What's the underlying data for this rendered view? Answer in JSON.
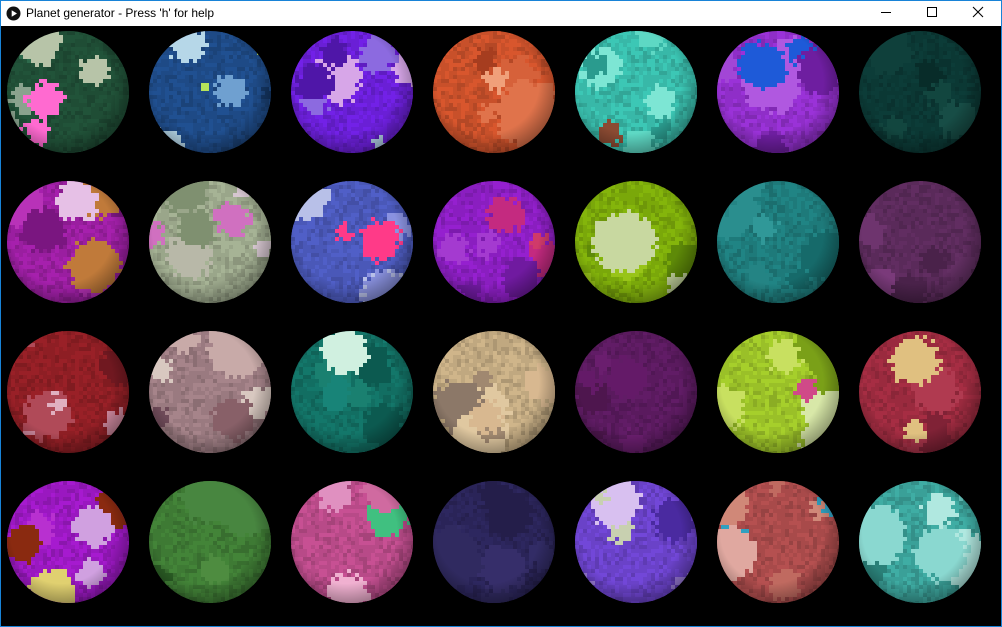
{
  "window": {
    "title": "Planet generator - Press 'h' for help",
    "icon": "play-circle-icon",
    "controls": {
      "minimize_icon": "minimize-icon",
      "maximize_icon": "maximize-icon",
      "close_icon": "close-icon"
    }
  },
  "colors": {
    "canvas_background": "#000000",
    "window_border": "#1883d7"
  },
  "planets": [
    {
      "base": "#1f4d35",
      "accents": [
        "#ff6ad0",
        "#b7c4a8",
        "#8aa38e",
        "#2d6a4c"
      ]
    },
    {
      "base": "#1e4a86",
      "accents": [
        "#b6d7e8",
        "#b7e35a",
        "#6fa0d0",
        "#143766"
      ]
    },
    {
      "base": "#6a1fd6",
      "accents": [
        "#d7a6e8",
        "#8c6ae0",
        "#4f16a8",
        "#b9d8f0"
      ]
    },
    {
      "base": "#c8502a",
      "accents": [
        "#e0734b",
        "#a63d1f",
        "#d6613a",
        "#f0a07a"
      ]
    },
    {
      "base": "#38b8a8",
      "accents": [
        "#5ed8c4",
        "#2a9b8e",
        "#7de6d4",
        "#8a4a32"
      ]
    },
    {
      "base": "#8f2ec8",
      "accents": [
        "#b058e0",
        "#6e1ea0",
        "#1e5ad8",
        "#a246d6"
      ]
    },
    {
      "base": "#0b3834",
      "accents": [
        "#12463f",
        "#082c29",
        "#0f403b",
        "#174d46"
      ]
    },
    {
      "base": "#9a1ea0",
      "accents": [
        "#b832b8",
        "#7a1680",
        "#c07a3a",
        "#e6c0e6"
      ]
    },
    {
      "base": "#9aa68a",
      "accents": [
        "#d6c6d0",
        "#d070c0",
        "#7f9070",
        "#b8b8a8"
      ]
    },
    {
      "base": "#4a58b8",
      "accents": [
        "#8a92e0",
        "#ff3a88",
        "#b8c0e8",
        "#3a46a0"
      ]
    },
    {
      "base": "#8a1ec0",
      "accents": [
        "#c42a80",
        "#a43ad0",
        "#701aa0",
        "#d03a6a"
      ]
    },
    {
      "base": "#7aa80a",
      "accents": [
        "#98c418",
        "#5e8a08",
        "#c8d8a0",
        "#88b810"
      ]
    },
    {
      "base": "#1e7a7a",
      "accents": [
        "#2a8e8e",
        "#166a6a",
        "#248484",
        "#309898"
      ]
    },
    {
      "base": "#5a2a5a",
      "accents": [
        "#6e346e",
        "#4a224a",
        "#643064",
        "#7a3a7a"
      ]
    },
    {
      "base": "#8e1e24",
      "accents": [
        "#d08aa0",
        "#b04a58",
        "#e0b0c0",
        "#701820"
      ]
    },
    {
      "base": "#9a7a80",
      "accents": [
        "#c8aaa8",
        "#6e4a58",
        "#d8c8c0",
        "#886068"
      ]
    },
    {
      "base": "#126e62",
      "accents": [
        "#1a8070",
        "#0c5a50",
        "#188478",
        "#d0f0e0"
      ]
    },
    {
      "base": "#c0a880",
      "accents": [
        "#e0c8a0",
        "#a08870",
        "#d8b890",
        "#8c7868"
      ]
    },
    {
      "base": "#5a1a5e",
      "accents": [
        "#6a1e6e",
        "#4e164e",
        "#641a68",
        "#702272"
      ]
    },
    {
      "base": "#9ac028",
      "accents": [
        "#c8e060",
        "#d8e8a8",
        "#7aa018",
        "#d04a88"
      ]
    },
    {
      "base": "#9a2a3e",
      "accents": [
        "#b03a50",
        "#802236",
        "#e0c080",
        "#a8344a"
      ]
    },
    {
      "base": "#9a18c0",
      "accents": [
        "#d0a0e0",
        "#e0d070",
        "#8a2a10",
        "#b830d0"
      ]
    },
    {
      "base": "#3e7a34",
      "accents": [
        "#4e8c40",
        "#326a2a",
        "#488640",
        "#2a5c24"
      ]
    },
    {
      "base": "#b84a88",
      "accents": [
        "#e090c0",
        "#d06aa0",
        "#f0b0d0",
        "#40c080"
      ]
    },
    {
      "base": "#2a2458",
      "accents": [
        "#322c66",
        "#241e4a",
        "#302a60",
        "#362e6a"
      ]
    },
    {
      "base": "#6a42c8",
      "accents": [
        "#a080e0",
        "#c8d0b0",
        "#4a2aa0",
        "#d8c0f0"
      ]
    },
    {
      "base": "#a84a4a",
      "accents": [
        "#d08878",
        "#30a0c0",
        "#c06a60",
        "#e0a8a0"
      ]
    },
    {
      "base": "#3aa098",
      "accents": [
        "#8ad8d0",
        "#b0e8e0",
        "#2a8078",
        "#68c8c0"
      ]
    }
  ]
}
